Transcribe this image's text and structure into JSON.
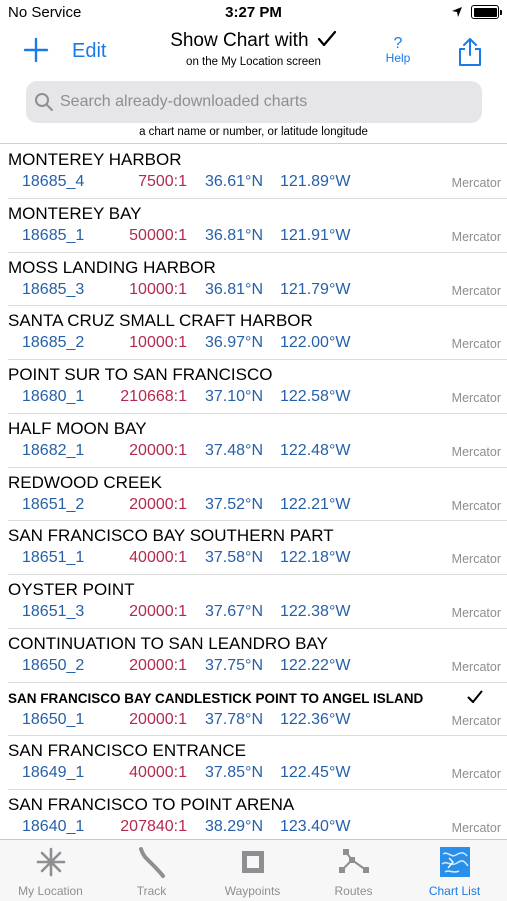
{
  "status_bar": {
    "carrier": "No Service",
    "time": "3:27 PM"
  },
  "nav": {
    "edit_label": "Edit",
    "title": "Show Chart with",
    "subtitle": "on the My Location screen",
    "help_label": "Help",
    "help_glyph": "?"
  },
  "search": {
    "placeholder": "Search already-downloaded charts",
    "hint": "a chart name or number, or latitude longitude"
  },
  "charts": [
    {
      "name": "MONTEREY HARBOR",
      "id": "18685_4",
      "scale": "7500:1",
      "lat": "36.61°N",
      "lon": "121.89°W",
      "projection": "Mercator"
    },
    {
      "name": "MONTEREY BAY",
      "id": "18685_1",
      "scale": "50000:1",
      "lat": "36.81°N",
      "lon": "121.91°W",
      "projection": "Mercator"
    },
    {
      "name": "MOSS LANDING HARBOR",
      "id": "18685_3",
      "scale": "10000:1",
      "lat": "36.81°N",
      "lon": "121.79°W",
      "projection": "Mercator"
    },
    {
      "name": "SANTA CRUZ SMALL CRAFT HARBOR",
      "id": "18685_2",
      "scale": "10000:1",
      "lat": "36.97°N",
      "lon": "122.00°W",
      "projection": "Mercator"
    },
    {
      "name": "POINT SUR TO SAN FRANCISCO",
      "id": "18680_1",
      "scale": "210668:1",
      "lat": "37.10°N",
      "lon": "122.58°W",
      "projection": "Mercator"
    },
    {
      "name": "HALF MOON BAY",
      "id": "18682_1",
      "scale": "20000:1",
      "lat": "37.48°N",
      "lon": "122.48°W",
      "projection": "Mercator"
    },
    {
      "name": "REDWOOD CREEK",
      "id": "18651_2",
      "scale": "20000:1",
      "lat": "37.52°N",
      "lon": "122.21°W",
      "projection": "Mercator"
    },
    {
      "name": "SAN FRANCISCO BAY SOUTHERN PART",
      "id": "18651_1",
      "scale": "40000:1",
      "lat": "37.58°N",
      "lon": "122.18°W",
      "projection": "Mercator"
    },
    {
      "name": "OYSTER POINT",
      "id": "18651_3",
      "scale": "20000:1",
      "lat": "37.67°N",
      "lon": "122.38°W",
      "projection": "Mercator"
    },
    {
      "name": "CONTINUATION TO SAN LEANDRO BAY",
      "id": "18650_2",
      "scale": "20000:1",
      "lat": "37.75°N",
      "lon": "122.22°W",
      "projection": "Mercator"
    },
    {
      "name": "SAN FRANCISCO BAY CANDLESTICK POINT TO ANGEL ISLAND",
      "id": "18650_1",
      "scale": "20000:1",
      "lat": "37.78°N",
      "lon": "122.36°W",
      "projection": "Mercator",
      "selected": true
    },
    {
      "name": "SAN FRANCISCO ENTRANCE",
      "id": "18649_1",
      "scale": "40000:1",
      "lat": "37.85°N",
      "lon": "122.45°W",
      "projection": "Mercator"
    },
    {
      "name": "SAN FRANCISCO TO POINT ARENA",
      "id": "18640_1",
      "scale": "207840:1",
      "lat": "38.29°N",
      "lon": "123.40°W",
      "projection": "Mercator"
    }
  ],
  "tabs": [
    {
      "label": "My Location",
      "icon": "compass-rose-icon"
    },
    {
      "label": "Track",
      "icon": "track-icon"
    },
    {
      "label": "Waypoints",
      "icon": "waypoint-square-icon"
    },
    {
      "label": "Routes",
      "icon": "route-icon"
    },
    {
      "label": "Chart List",
      "icon": "chart-list-icon",
      "active": true
    }
  ],
  "colors": {
    "accent": "#1a7ae6",
    "chart_id": "#2660a8",
    "scale": "#b32a4e",
    "projection": "#8e8e93"
  }
}
